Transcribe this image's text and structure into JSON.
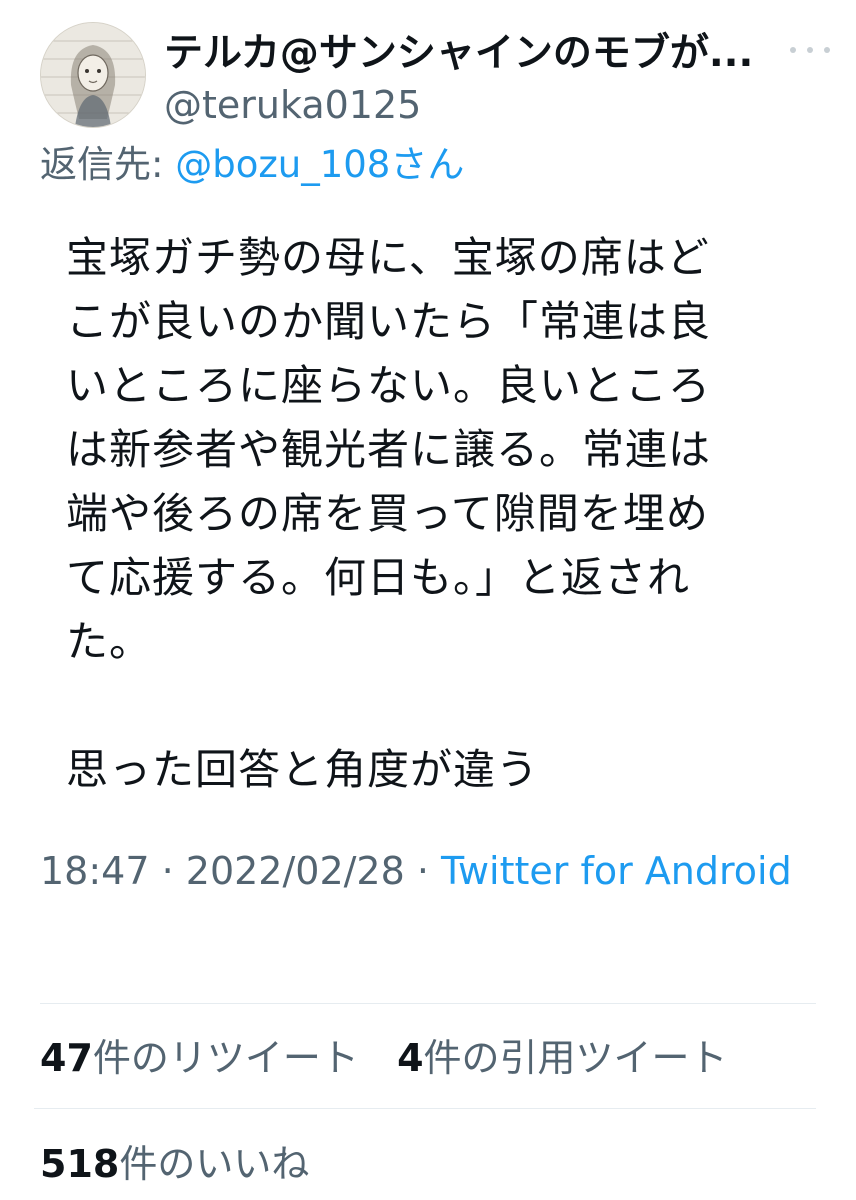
{
  "author": {
    "display_name": "テルカ@サンシャインのモブが...",
    "handle": "@teruka0125",
    "avatar_icon": "avatar-illustration"
  },
  "reply": {
    "prefix": "返信先: ",
    "target": "@bozu_108さん"
  },
  "tweet": {
    "lines": [
      "宝塚ガチ勢の母に、宝塚の席はど",
      "こが良いのか聞いたら「常連は良",
      "いところに座らない。良いところ",
      "は新参者や観光者に譲る。常連は",
      "端や後ろの席を買って隙間を埋め",
      "て応援する。何日も。」と返され",
      "た。"
    ],
    "closing": "思った回答と角度が違う"
  },
  "meta": {
    "time": "18:47",
    "separator": " · ",
    "date": "2022/02/28",
    "source": "Twitter for Android"
  },
  "stats": {
    "retweets": {
      "count": "47",
      "label": "件のリツイート"
    },
    "quotes": {
      "count": "4",
      "label": "件の引用ツイート"
    },
    "likes": {
      "count": "518",
      "label": "件のいいね"
    }
  },
  "colors": {
    "link": "#1d9bf0",
    "secondary_text": "#536471",
    "primary_text": "#0f1419",
    "divider": "#e6ecf0"
  }
}
